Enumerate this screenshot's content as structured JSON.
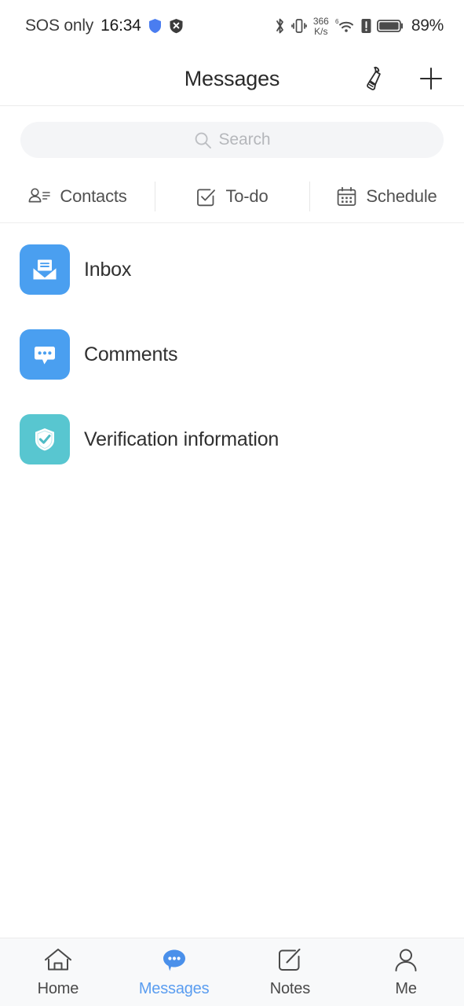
{
  "status_bar": {
    "carrier": "SOS only",
    "time": "16:34",
    "net_speed_value": "366",
    "net_speed_unit": "K/s",
    "wifi_gen": "6",
    "battery_percent": "89%",
    "icons": [
      "shield-blue-icon",
      "shield-x-icon",
      "bluetooth-icon",
      "vibrate-icon",
      "wifi-icon",
      "alert-icon",
      "battery-icon"
    ]
  },
  "header": {
    "title": "Messages",
    "clean_icon": "broom-icon",
    "add_icon": "plus-icon"
  },
  "search": {
    "placeholder": "Search",
    "icon": "search-icon"
  },
  "quick_actions": [
    {
      "label": "Contacts",
      "icon": "contacts-icon"
    },
    {
      "label": "To-do",
      "icon": "checkbox-icon"
    },
    {
      "label": "Schedule",
      "icon": "calendar-icon"
    }
  ],
  "list": [
    {
      "label": "Inbox",
      "icon": "envelope-icon",
      "color": "#4a9ff0"
    },
    {
      "label": "Comments",
      "icon": "comment-bubble-icon",
      "color": "#4a9ff0"
    },
    {
      "label": "Verification information",
      "icon": "shield-check-icon",
      "color": "#58c6d0"
    }
  ],
  "bottom_nav": {
    "active": "Messages",
    "items": [
      {
        "label": "Home",
        "icon": "home-icon"
      },
      {
        "label": "Messages",
        "icon": "message-bubble-icon"
      },
      {
        "label": "Notes",
        "icon": "note-edit-icon"
      },
      {
        "label": "Me",
        "icon": "person-icon"
      }
    ]
  },
  "colors": {
    "accent_blue": "#4a9ff0",
    "accent_teal": "#58c6d0",
    "nav_active": "#5a9df0",
    "search_bg": "#f4f5f7"
  }
}
